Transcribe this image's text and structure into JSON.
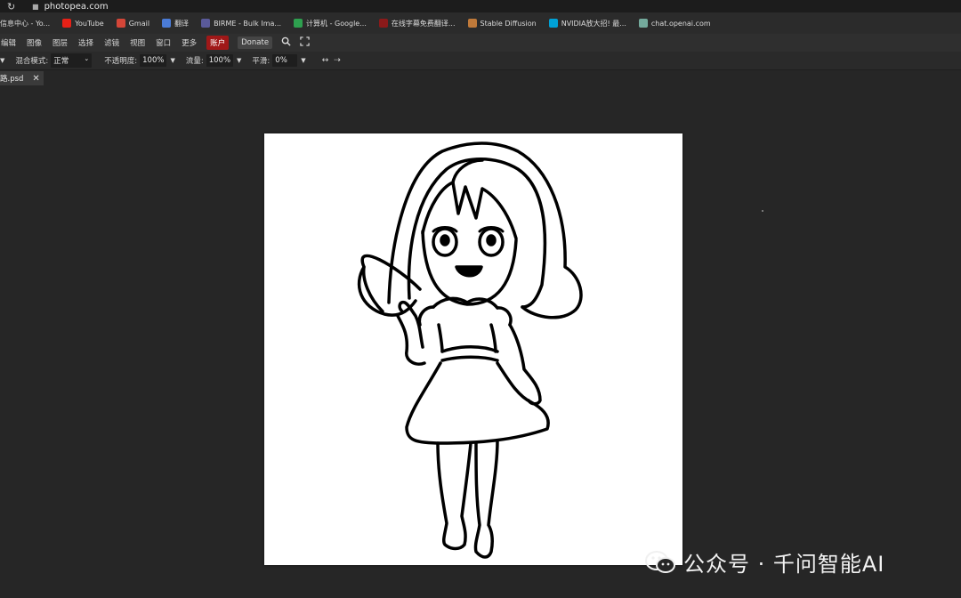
{
  "browser": {
    "url": "photopea.com",
    "bookmarks": [
      {
        "label": "信息中心 - Yo...",
        "icon": "dashboard-icon",
        "color": "#3a3a3a"
      },
      {
        "label": "YouTube",
        "icon": "youtube-icon",
        "color": "#e62117"
      },
      {
        "label": "Gmail",
        "icon": "gmail-icon",
        "color": "#d44638"
      },
      {
        "label": "翻译",
        "icon": "translate-icon",
        "color": "#4a7bd6"
      },
      {
        "label": "BIRME - Bulk Ima...",
        "icon": "birme-icon",
        "color": "#5a5a9a"
      },
      {
        "label": "计算机 - Google...",
        "icon": "drive-icon",
        "color": "#2ea04f"
      },
      {
        "label": "在线字幕免费翻译...",
        "icon": "subtitle-icon",
        "color": "#8b1a1a"
      },
      {
        "label": "Stable Diffusion",
        "icon": "stable-diffusion-icon",
        "color": "#c07a3a"
      },
      {
        "label": "NVIDIA放大招! 最...",
        "icon": "bilibili-icon",
        "color": "#00a1d6"
      },
      {
        "label": "chat.openai.com",
        "icon": "openai-icon",
        "color": "#74aa9c"
      }
    ]
  },
  "menu": {
    "items": [
      "编辑",
      "图像",
      "图层",
      "选择",
      "滤镜",
      "视图",
      "窗口",
      "更多"
    ],
    "account": "账户",
    "donate": "Donate"
  },
  "options": {
    "blend_label": "混合模式:",
    "blend_value": "正常",
    "opacity_label": "不透明度:",
    "opacity_value": "100%",
    "flow_label": "流量:",
    "flow_value": "100%",
    "smooth_label": "平滑:",
    "smooth_value": "0%"
  },
  "document": {
    "tab_name": "路.psd"
  },
  "watermark": {
    "text": "公众号 · 千问智能AI"
  },
  "colors": {
    "background": "#262626",
    "account_red": "#a01818",
    "canvas": "#ffffff"
  }
}
